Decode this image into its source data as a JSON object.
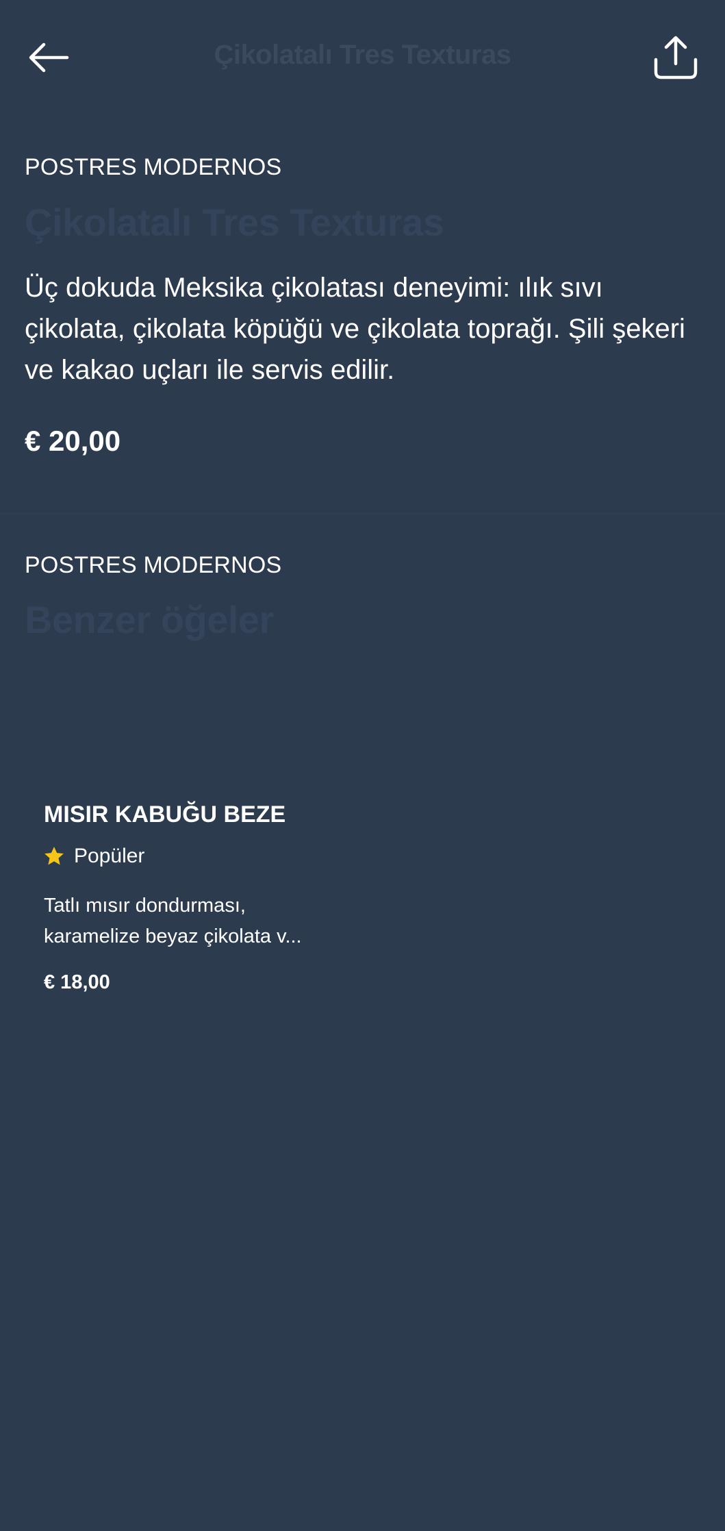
{
  "header": {
    "title": "Çikolatalı Tres Texturas",
    "back_icon": "arrow-left-icon",
    "share_icon": "share-icon"
  },
  "item": {
    "category": "POSTRES MODERNOS",
    "title": "Çikolatalı Tres Texturas",
    "description": "Üç dokuda Meksika çikolatası deneyimi: ılık sıvı çikolata, çikolata köpüğü ve çikolata toprağı. Şili şekeri ve kakao uçları ile servis edilir.",
    "price": "€ 20,00"
  },
  "similar": {
    "category": "POSTRES MODERNOS",
    "title": "Benzer öğeler",
    "items": [
      {
        "title": "MISIR KABUĞU BEZE",
        "badge_icon": "star-icon",
        "badge": "Popüler",
        "badge_color": "#f5c518",
        "description": "Tatlı mısır dondurması, karamelize beyaz çikolata v...",
        "price": "€ 18,00"
      }
    ]
  },
  "colors": {
    "background": "#2c3b4e",
    "muted_title": "#34445a",
    "text": "#ffffff"
  }
}
